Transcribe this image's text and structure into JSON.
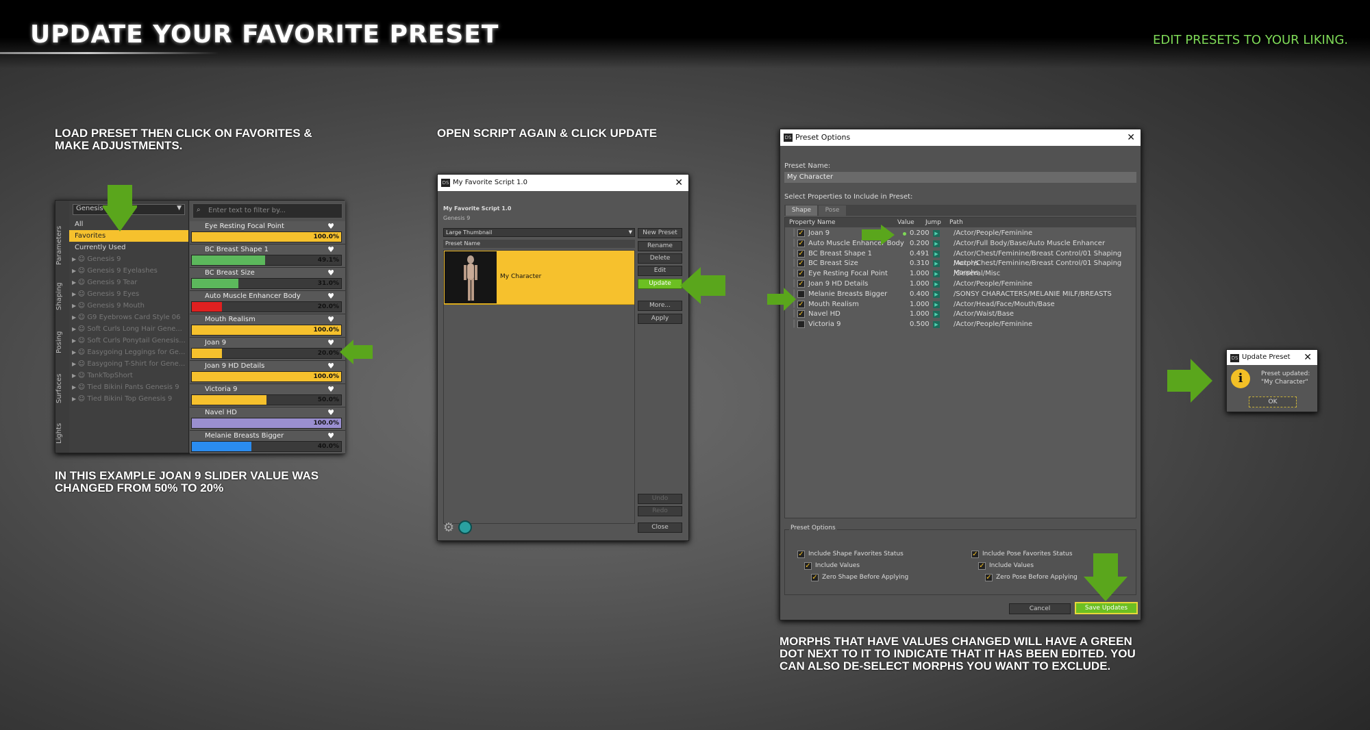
{
  "header": {
    "title": "UPDATE YOUR FAVORITE PRESET",
    "subtitle": "EDIT PRESETS TO YOUR LIKING."
  },
  "captions": {
    "step1": "LOAD PRESET THEN CLICK ON FAVORITES & MAKE ADJUSTMENTS.",
    "step1_note": "IN THIS EXAMPLE JOAN 9 SLIDER VALUE WAS CHANGED FROM 50% TO 20%",
    "step2": "OPEN SCRIPT AGAIN & CLICK UPDATE",
    "step3_note": "MORPHS THAT HAVE VALUES CHANGED WILL HAVE A GREEN DOT NEXT TO IT TO INDICATE THAT IT HAS BEEN EDITED. YOU CAN ALSO DE-SELECT MORPHS YOU WANT TO EXCLUDE."
  },
  "colors": {
    "accent": "#7ed957",
    "arrow": "#5aa61c",
    "highlight": "#f6c12d"
  },
  "params_pane": {
    "vertical_tabs": [
      "Parameters",
      "Shaping",
      "Posing",
      "Surfaces",
      "Lights"
    ],
    "figure_dropdown": "Genesis 9",
    "filter_placeholder": "Enter text to filter by...",
    "categories": [
      "All",
      "Favorites",
      "Currently Used"
    ],
    "selected_category": "Favorites",
    "figures": [
      "Genesis 9",
      "Genesis 9 Eyelashes",
      "Genesis 9 Tear",
      "Genesis 9 Eyes",
      "Genesis 9 Mouth",
      "G9 Eyebrows Card Style 06",
      "Soft Curls Long Hair Gene...",
      "Soft Curls Ponytail Genesis...",
      "Easygoing Leggings for Ge...",
      "Easygoing T-Shirt for Gene...",
      "TankTopShort",
      "Tied Bikini Pants Genesis 9",
      "Tied Bikini Top Genesis 9"
    ],
    "properties": [
      {
        "name": "Eye Resting Focal Point",
        "value": "100.0%",
        "level": 1.0,
        "color": "#f6c12d"
      },
      {
        "name": "BC Breast Shape 1",
        "value": "49.1%",
        "level": 0.49,
        "color": "#5cb85c"
      },
      {
        "name": "BC Breast Size",
        "value": "31.0%",
        "level": 0.31,
        "color": "#5cb85c"
      },
      {
        "name": "Auto Muscle Enhancer Body",
        "value": "20.0%",
        "level": 0.2,
        "color": "#e02020"
      },
      {
        "name": "Mouth Realism",
        "value": "100.0%",
        "level": 1.0,
        "color": "#f6c12d"
      },
      {
        "name": "Joan 9",
        "value": "20.0%",
        "level": 0.2,
        "color": "#f6c12d"
      },
      {
        "name": "Joan 9 HD Details",
        "value": "100.0%",
        "level": 1.0,
        "color": "#f6c12d"
      },
      {
        "name": "Victoria 9",
        "value": "50.0%",
        "level": 0.5,
        "color": "#f6c12d"
      },
      {
        "name": "Navel HD",
        "value": "100.0%",
        "level": 1.0,
        "color": "#9a8fd0"
      },
      {
        "name": "Melanie Breasts Bigger",
        "value": "40.0%",
        "level": 0.4,
        "color": "#2a8cf0"
      }
    ]
  },
  "script_dialog": {
    "title": "My Favorite Script 1.0",
    "heading": "My Favorite Script 1.0",
    "figure": "Genesis 9",
    "view_mode": "Large Thumbnail",
    "column_header": "Preset Name",
    "preset": "My Character",
    "buttons": {
      "new": "New Preset",
      "rename": "Rename",
      "delete": "Delete",
      "edit": "Edit",
      "update": "Update",
      "more": "More...",
      "apply": "Apply",
      "undo": "Undo",
      "redo": "Redo",
      "close": "Close"
    }
  },
  "preset_options": {
    "title": "Preset Options",
    "name_label": "Preset Name:",
    "name_value": "My Character",
    "select_label": "Select Properties to Include in Preset:",
    "tabs": [
      "Shape",
      "Pose"
    ],
    "columns": [
      "Property Name",
      "Value",
      "Jump",
      "Path"
    ],
    "rows": [
      {
        "name": "Joan 9",
        "value": "0.200",
        "path": "/Actor/People/Feminine",
        "checked": true,
        "edited": true
      },
      {
        "name": "Auto Muscle Enhancer Body",
        "value": "0.200",
        "path": "/Actor/Full Body/Base/Auto Muscle Enhancer",
        "checked": true,
        "edited": false
      },
      {
        "name": "BC Breast Shape 1",
        "value": "0.491",
        "path": "/Actor/Chest/Feminine/Breast Control/01 Shaping Morphs",
        "checked": true,
        "edited": false
      },
      {
        "name": "BC Breast Size",
        "value": "0.310",
        "path": "/Actor/Chest/Feminine/Breast Control/01 Shaping Morphs",
        "checked": true,
        "edited": false
      },
      {
        "name": "Eye Resting Focal Point",
        "value": "1.000",
        "path": "/General/Misc",
        "checked": true,
        "edited": false
      },
      {
        "name": "Joan 9 HD Details",
        "value": "1.000",
        "path": "/Actor/People/Feminine",
        "checked": true,
        "edited": false
      },
      {
        "name": "Melanie Breasts Bigger",
        "value": "0.400",
        "path": "/SONSY CHARACTERS/MELANIE MILF/BREASTS",
        "checked": false,
        "edited": false
      },
      {
        "name": "Mouth Realism",
        "value": "1.000",
        "path": "/Actor/Head/Face/Mouth/Base",
        "checked": true,
        "edited": false
      },
      {
        "name": "Navel HD",
        "value": "1.000",
        "path": "/Actor/Waist/Base",
        "checked": true,
        "edited": false
      },
      {
        "name": "Victoria 9",
        "value": "0.500",
        "path": "/Actor/People/Feminine",
        "checked": false,
        "edited": false
      }
    ],
    "options_title": "Preset Options",
    "options": {
      "shape_fav": "Include Shape Favorites Status",
      "shape_vals": "Include Values",
      "shape_zero": "Zero Shape Before Applying",
      "pose_fav": "Include Pose Favorites Status",
      "pose_vals": "Include Values",
      "pose_zero": "Zero Pose Before Applying"
    },
    "cancel": "Cancel",
    "save": "Save Updates"
  },
  "popup": {
    "title": "Update Preset",
    "message_line1": "Preset updated:",
    "message_line2": "\"My Character\"",
    "ok": "OK"
  }
}
